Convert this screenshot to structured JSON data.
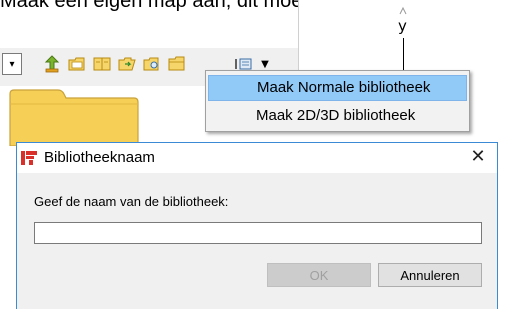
{
  "document": {
    "heading_text": "Maak een eigen map aan, dit moet met de één",
    "scroll_caret": "^"
  },
  "drawing": {
    "axis_label": "y"
  },
  "toolbar": {
    "combo_arrow": "▾",
    "icons": [
      "upload-arrow-icon",
      "open-folder-icon",
      "book-icon",
      "folder-arrow-icon",
      "folder-search-icon",
      "folder-icon",
      "library-menu-icon"
    ],
    "dropdown_arrow": "▼"
  },
  "context_menu": {
    "items": [
      {
        "label": "Maak Normale bibliotheek",
        "highlighted": true
      },
      {
        "label": "Maak 2D/3D bibliotheek",
        "highlighted": false
      }
    ]
  },
  "dialog": {
    "title": "Bibliotheeknaam",
    "close_label": "✕",
    "prompt": "Geef de naam van de bibliotheek:",
    "input_value": "",
    "ok_label": "OK",
    "ok_enabled": false,
    "cancel_label": "Annuleren"
  },
  "colors": {
    "menu_highlight": "#91c9f7",
    "dialog_border": "#3b8ad6",
    "folder_yellow": "#f5cf56",
    "app_icon_red": "#d9302b"
  }
}
